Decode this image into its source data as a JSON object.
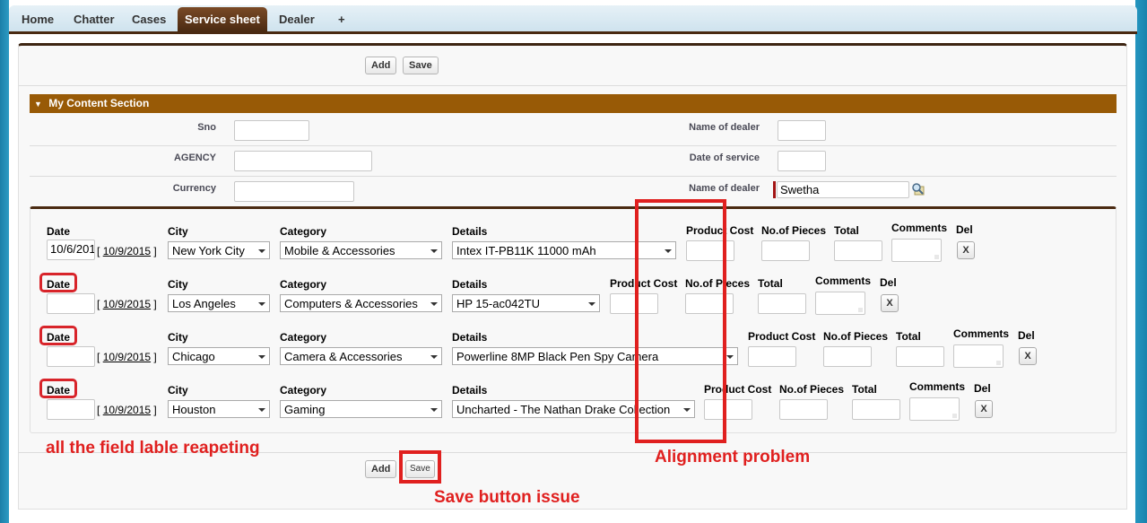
{
  "tabs": [
    {
      "label": "Home",
      "active": false
    },
    {
      "label": "Chatter",
      "active": false
    },
    {
      "label": "Cases",
      "active": false
    },
    {
      "label": "Service sheet",
      "active": true
    },
    {
      "label": "Dealer",
      "active": false
    },
    {
      "label": "+",
      "active": false
    }
  ],
  "toolbar": {
    "add_label": "Add",
    "save_label": "Save"
  },
  "section": {
    "title": "My Content Section",
    "collapse_icon": "triangle-down-icon",
    "left_fields": [
      {
        "label": "Sno",
        "value": ""
      },
      {
        "label": "AGENCY",
        "value": ""
      },
      {
        "label": "Currency",
        "value": ""
      }
    ],
    "right_fields": [
      {
        "label": "Name of dealer",
        "value": ""
      },
      {
        "label": "Date of service",
        "value": ""
      },
      {
        "label": "Name of dealer",
        "value": "Swetha",
        "required": true,
        "lookup_icon": "lookup-magnifier-icon"
      }
    ]
  },
  "columns": {
    "date": "Date",
    "city": "City",
    "category": "Category",
    "details": "Details",
    "product_cost": "Product Cost",
    "pieces": "No.of Pieces",
    "total": "Total",
    "comments": "Comments",
    "del": "Del",
    "del_button": "X"
  },
  "rows": [
    {
      "date_value": "10/6/201",
      "today_link": "10/9/2015",
      "city": "New York City",
      "category": "Mobile & Accessories",
      "details": "Intex IT-PB11K 11000 mAh"
    },
    {
      "date_value": "",
      "today_link": "10/9/2015",
      "city": "Los Angeles",
      "category": "Computers & Accessories",
      "details": "HP 15-ac042TU"
    },
    {
      "date_value": "",
      "today_link": "10/9/2015",
      "city": "Chicago",
      "category": "Camera & Accessories",
      "details": "Powerline 8MP Black Pen Spy Camera"
    },
    {
      "date_value": "",
      "today_link": "10/9/2015",
      "city": "Houston",
      "category": "Gaming",
      "details": "Uncharted - The Nathan Drake Collection"
    }
  ],
  "bracket_open": "[",
  "bracket_close": "]",
  "annotations": {
    "labels_repeating": "all the field lable reapeting",
    "alignment": "Alignment problem",
    "save_issue": "Save button issue",
    "color": "#e0201f"
  }
}
